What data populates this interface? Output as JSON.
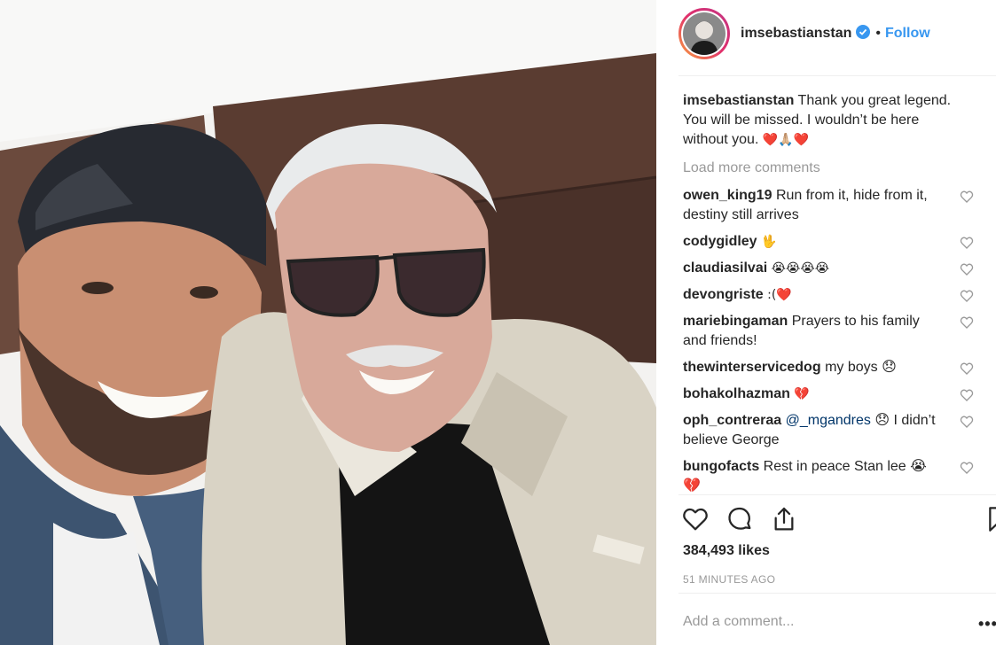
{
  "post": {
    "author": "imsebastianstan",
    "follow_label": "Follow",
    "separator": "•",
    "caption_text": "Thank you great legend. You will be missed. I wouldn’t be here without you.",
    "caption_emoji": "❤️🙏🏼❤️",
    "load_more_label": "Load more comments",
    "likes_label": "384,493 likes",
    "timestamp": "51 MINUTES AGO",
    "add_comment_placeholder": "Add a comment...",
    "more_options_label": "•••"
  },
  "comments": [
    {
      "user": "owen_king19",
      "text": "Run from it, hide from it, destiny still arrives"
    },
    {
      "user": "codygidley",
      "text": "🖖"
    },
    {
      "user": "claudiasilvai",
      "text": "😭😭😭😭"
    },
    {
      "user": "devongriste",
      "text": ":(❤️"
    },
    {
      "user": "mariebingaman",
      "text": "Prayers to his family and friends!"
    },
    {
      "user": "thewinterservicedog",
      "text": "my boys 😞"
    },
    {
      "user": "bohakolhazman",
      "text": "💔"
    },
    {
      "user": "oph_contreraa",
      "mention": "@_mgandres",
      "text": "😞 I didn’t believe George"
    },
    {
      "user": "bungofacts",
      "text": "Rest in peace Stan lee 😭💔"
    }
  ],
  "icons": {
    "verified": "verified-badge-icon",
    "comment_like": "heart-outline-icon",
    "like": "heart-icon",
    "comment": "comment-bubble-icon",
    "share": "share-icon",
    "save": "bookmark-icon"
  },
  "colors": {
    "accent": "#3897f0",
    "muted": "#999999",
    "text": "#262626",
    "verified": "#3897f0"
  }
}
